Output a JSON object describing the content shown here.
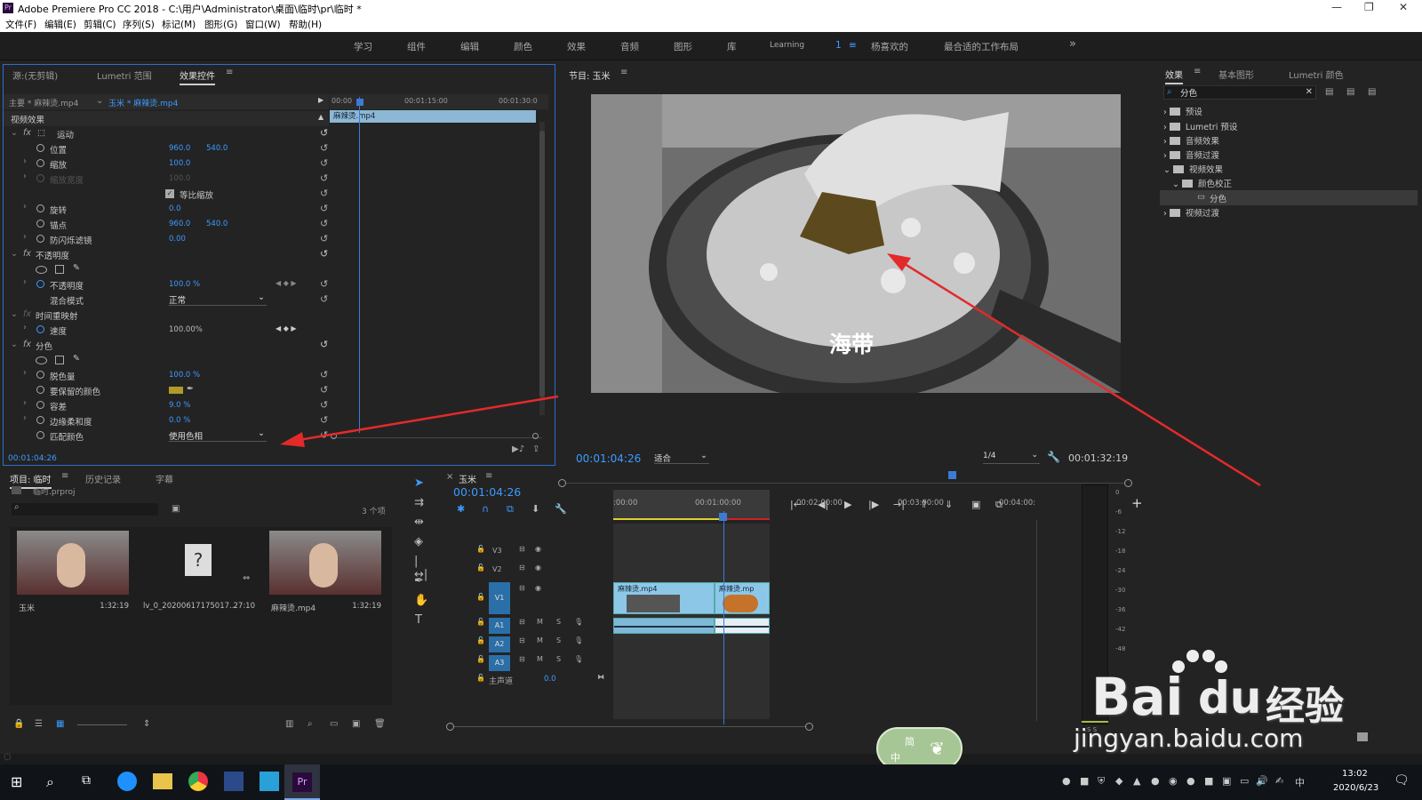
{
  "app": {
    "title": "Adobe Premiere Pro CC 2018 - C:\\用户\\Administrator\\桌面\\临时\\pr\\临时 *"
  },
  "menu": [
    "文件(F)",
    "编辑(E)",
    "剪辑(C)",
    "序列(S)",
    "标记(M)",
    "图形(G)",
    "窗口(W)",
    "帮助(H)"
  ],
  "workspaces": [
    "学习",
    "组件",
    "编辑",
    "颜色",
    "效果",
    "音频",
    "图形",
    "库",
    "Learning",
    "1",
    "杨喜欢的",
    "最合适的工作布局",
    "»"
  ],
  "effect_controls": {
    "tabs": [
      "源:(无剪辑)",
      "Lumetri 范围",
      "效果控件"
    ],
    "master": "主要 * 麻辣烫.mp4",
    "seq": "玉米 * 麻辣烫.mp4",
    "ruler": [
      "00:00",
      "00:01:15:00",
      "00:01:30:0"
    ],
    "clip_label": "麻辣烫.mp4",
    "video_effects": "视频效果",
    "motion": "运动",
    "position": "位置",
    "pos_x": "960.0",
    "pos_y": "540.0",
    "scale": "缩放",
    "scale_val": "100.0",
    "scale_w": "缩放宽度",
    "scale_w_val": "100.0",
    "uniform": "等比缩放",
    "rotation": "旋转",
    "rotation_val": "0.0",
    "anchor": "锚点",
    "anchor_x": "960.0",
    "anchor_y": "540.0",
    "flicker": "防闪烁滤镜",
    "flicker_val": "0.00",
    "opacity_sec": "不透明度",
    "opacity": "不透明度",
    "opacity_val": "100.0 %",
    "blend": "混合模式",
    "blend_val": "正常",
    "time_remap": "时间重映射",
    "speed": "速度",
    "speed_val": "100.00%",
    "leave_color": "分色",
    "decolor": "脱色量",
    "decolor_val": "100.0 %",
    "color_keep": "要保留的颜色",
    "tolerance": "容差",
    "tolerance_val": "9.0 %",
    "edge": "边缘柔和度",
    "edge_val": "0.0 %",
    "match": "匹配颜色",
    "match_val": "使用色相",
    "timecode": "00:01:04:26"
  },
  "program": {
    "title": "节目: 玉米",
    "caption": "海带",
    "timecode": "00:01:04:26",
    "fit": "适合",
    "res": "1/4",
    "duration": "00:01:32:19"
  },
  "effects": {
    "tabs": [
      "效果",
      "基本图形",
      "Lumetri 颜色"
    ],
    "search": "分色",
    "tree": [
      "预设",
      "Lumetri 预设",
      "音频效果",
      "音频过渡",
      "视频效果",
      "颜色校正",
      "分色",
      "视频过渡"
    ]
  },
  "project": {
    "tabs": [
      "项目: 临时",
      "历史记录",
      "字幕"
    ],
    "file": "临时.prproj",
    "count": "3 个项",
    "items": [
      {
        "name": "玉米",
        "dur": "1:32:19"
      },
      {
        "name": "lv_0_20200617175017...",
        "dur": "27:10"
      },
      {
        "name": "麻辣烫.mp4",
        "dur": "1:32:19"
      }
    ]
  },
  "timeline": {
    "title": "玉米",
    "timecode": "00:01:04:26",
    "ruler": [
      ":00:00",
      "00:01:00:00",
      "00:02:00:00",
      "00:03:00:00",
      "00:04:00:"
    ],
    "tracks": [
      "V3",
      "V2",
      "V1",
      "A1",
      "A2",
      "A3"
    ],
    "master": "主声道",
    "master_val": "0.0",
    "clip1": "麻辣烫.mp4",
    "clip2": "麻辣烫.mp"
  },
  "meter": [
    "0",
    "-6",
    "-12",
    "-18",
    "-24",
    "-30",
    "-36",
    "-42",
    "-48"
  ],
  "meter_foot": "S   S",
  "ime": {
    "a": "简",
    "b": "中"
  },
  "watermark": {
    "brand": "Bai",
    "brand2": "经验",
    "url": "jingyan.baidu.com"
  },
  "tray": {
    "time": "13:02",
    "date": "2020/6/23",
    "lang": "中"
  }
}
